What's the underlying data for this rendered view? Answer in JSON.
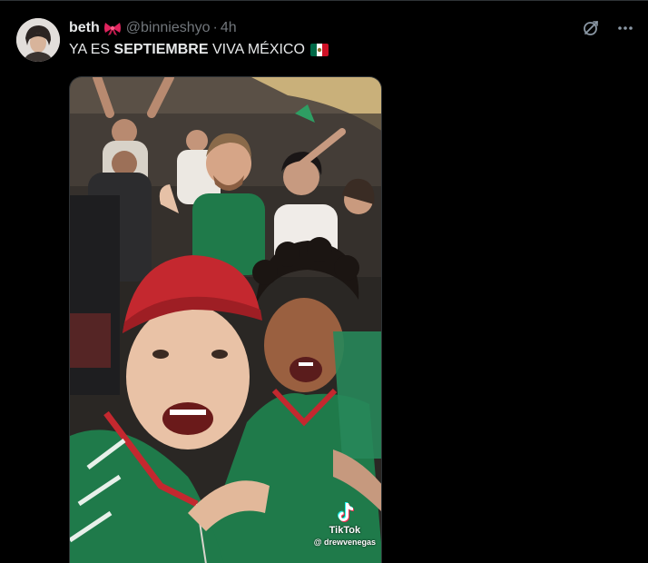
{
  "tweet": {
    "author_name": "beth",
    "author_emoji": "bow-emoji",
    "handle": "@binnieshyo",
    "separator": "·",
    "time": "4h",
    "text_before": "YA ES ",
    "text_bold": "SEPTIEMBRE",
    "text_after": " VIVA MÉXICO",
    "text_emoji": "mexico-flag"
  },
  "actions": {
    "grok_icon": "grok-icon",
    "more_icon": "more-icon"
  },
  "media": {
    "watermark_label": "TikTok",
    "watermark_user": "@ drewvenegas"
  },
  "colors": {
    "background": "#000000",
    "text_primary": "#e7e9ea",
    "text_secondary": "#71767b",
    "jersey_green": "#1f7a4a",
    "cap_red": "#c4282f"
  }
}
